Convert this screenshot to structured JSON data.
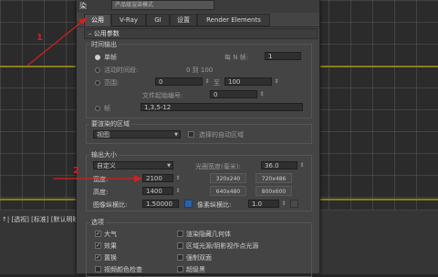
{
  "colors": {
    "annotation_red": "#d02020",
    "accent_blue": "#2f5fa8",
    "grid_yellow": "#8a7d16"
  },
  "viewport": {
    "status_text": "↑| [透视] [标准] [默认明暗处理]"
  },
  "dialog": {
    "title_fragment": "染",
    "renderer_value": "产品级渲染模式"
  },
  "tabs": [
    {
      "label": "公用",
      "active": true
    },
    {
      "label": "V-Ray",
      "active": false
    },
    {
      "label": "GI",
      "active": false
    },
    {
      "label": "设置",
      "active": false
    },
    {
      "label": "Render Elements",
      "active": false
    }
  ],
  "common_params": {
    "rollout_title": "公用参数",
    "time_output": {
      "title": "时间输出",
      "single_label": "单帧",
      "every_n_label": "每 N 帧:",
      "every_n_value": "1",
      "active_segment_label": "活动时间段:",
      "active_segment_range": "0 到 100",
      "range_label": "范围:",
      "range_from": "0",
      "range_to_label": "至",
      "range_to": "100",
      "file_start_label": "文件起始编号:",
      "file_start_value": "0",
      "frames_label": "帧",
      "frames_value": "1,3,5-12"
    },
    "area_to_render": {
      "title": "要渲染的区域",
      "value": "视图",
      "auto_region_label": "选择的自动区域"
    },
    "output_size": {
      "title": "输出大小",
      "preset_value": "自定义",
      "aperture_label": "光圈宽度(毫米):",
      "aperture_value": "36.0",
      "width_label": "宽度:",
      "width_value": "2100",
      "height_label": "高度:",
      "height_value": "1400",
      "presets": [
        "320x240",
        "720x486",
        "640x480",
        "800x600"
      ],
      "image_aspect_label": "图像纵横比:",
      "image_aspect_value": "1.50000",
      "pixel_aspect_label": "像素纵横比:",
      "pixel_aspect_value": "1.0"
    },
    "options": {
      "title": "选项",
      "left": [
        {
          "label": "大气",
          "checked": true
        },
        {
          "label": "效果",
          "checked": true
        },
        {
          "label": "置换",
          "checked": true
        },
        {
          "label": "视频颜色检查",
          "checked": false
        }
      ],
      "right": [
        {
          "label": "渲染隐藏几何体",
          "checked": false
        },
        {
          "label": "区域光源/阴影视作点光源",
          "checked": false
        },
        {
          "label": "强制双面",
          "checked": false
        },
        {
          "label": "超级黑",
          "checked": false
        }
      ]
    }
  },
  "annotations": [
    "1",
    "2"
  ]
}
